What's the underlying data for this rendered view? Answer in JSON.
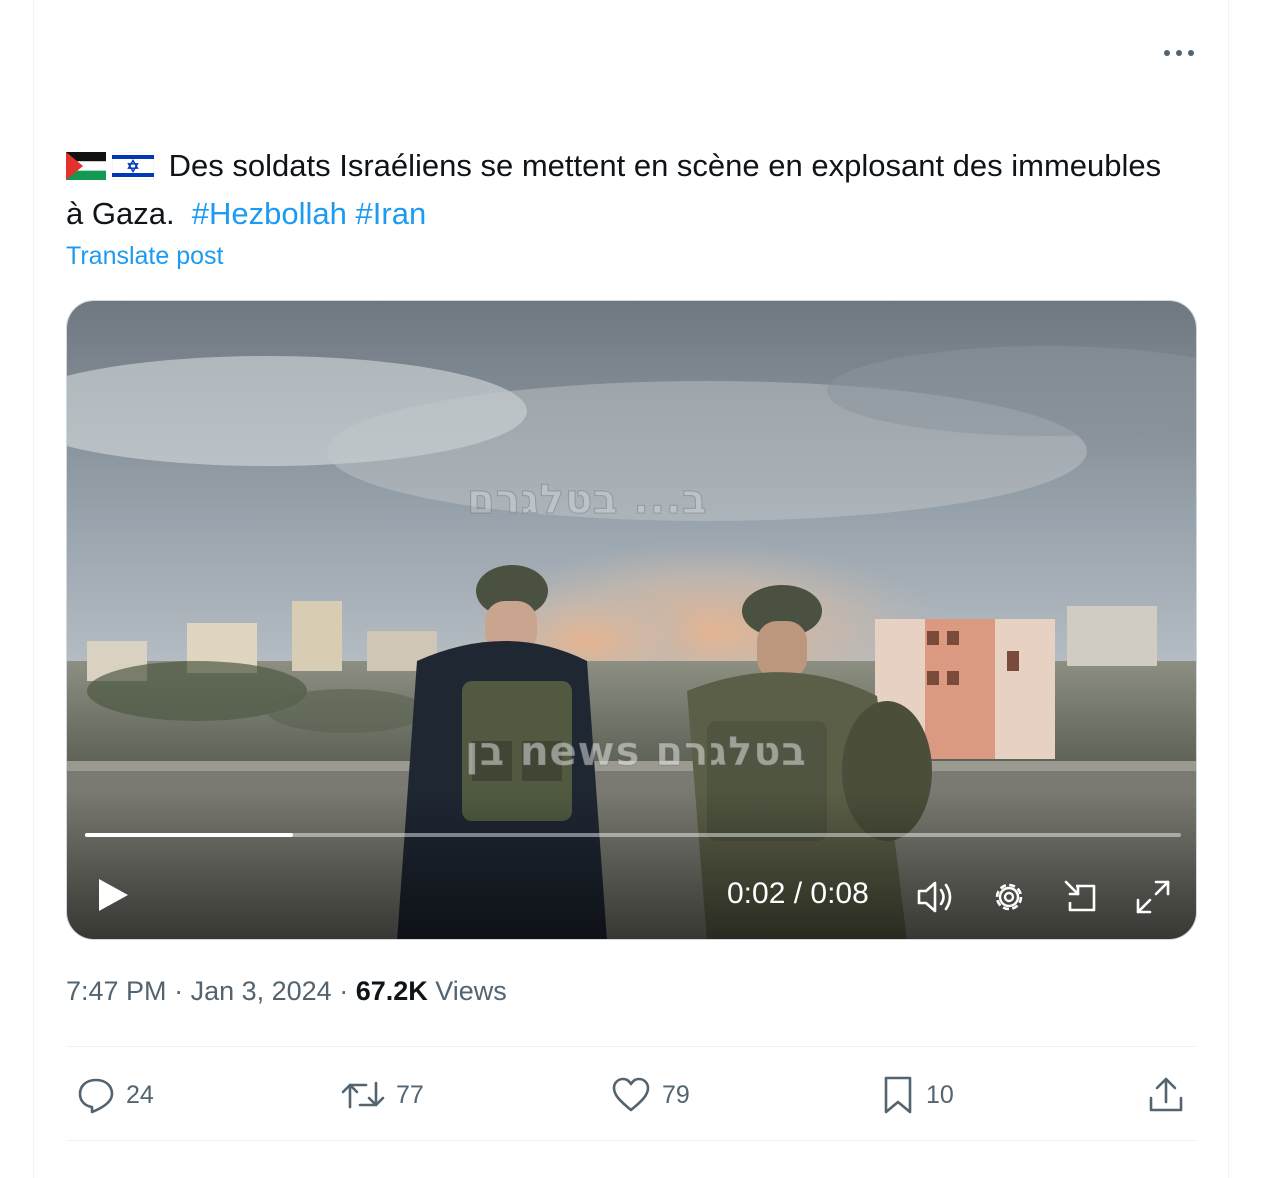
{
  "post": {
    "text": "Des soldats Israéliens se mettent en scène en explosant des immeubles à Gaza.",
    "hashtags": [
      "#Hezbollah",
      "#Iran"
    ],
    "translate_label": "Translate post",
    "flag_icons": [
      "palestine-flag-icon",
      "israel-flag-icon"
    ]
  },
  "video": {
    "watermark_top": "ב... בטלגרם",
    "watermark_bottom": "בן news בטלגרם",
    "current_time": "0:02",
    "separator": " / ",
    "duration": "0:08",
    "progress_fraction": 0.19
  },
  "meta": {
    "time": "7:47 PM",
    "sep": " · ",
    "date": "Jan 3, 2024",
    "views_count": "67.2K",
    "views_label": "Views"
  },
  "actions": {
    "replies": "24",
    "reposts": "77",
    "likes": "79",
    "bookmarks": "10"
  },
  "colors": {
    "accent": "#1d9bf0",
    "secondary_text": "#536471",
    "primary_text": "#0f1419"
  }
}
